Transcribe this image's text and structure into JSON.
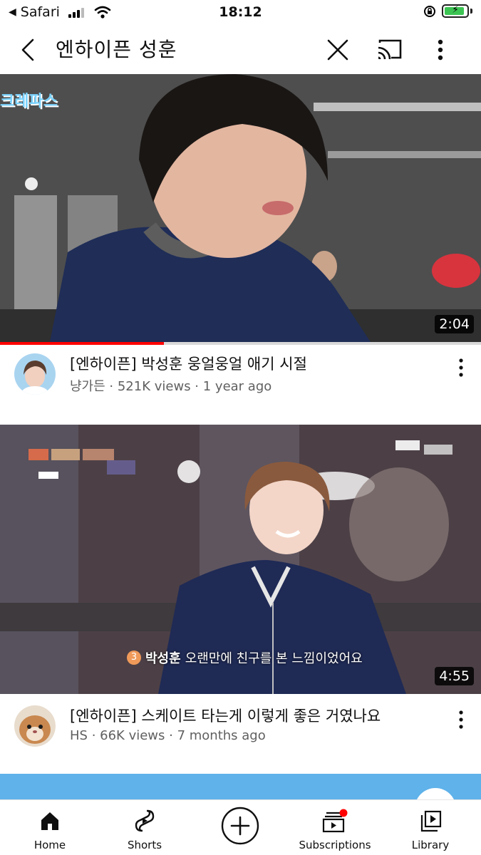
{
  "status_bar": {
    "back_app": "Safari",
    "time": "18:12"
  },
  "search": {
    "query": "엔하이픈 성훈"
  },
  "videos": [
    {
      "title": "[엔하이픈] 박성훈 웅얼웅얼 애기 시절",
      "channel": "냥가든",
      "views": "521K views",
      "age": "1 year ago",
      "duration": "2:04",
      "thumbnail_overlay_text": "크레파스",
      "watch_progress": 0.34
    },
    {
      "title": "[엔하이픈] 스케이트 타는게 이렇게 좋은 거였나요",
      "channel": "HS",
      "views": "66K views",
      "age": "7 months ago",
      "duration": "4:55",
      "subtitle_badge": "3",
      "subtitle_name": "박성훈",
      "subtitle_text": "오랜만에 친구를 본 느낌이었어요"
    }
  ],
  "separator": " · ",
  "bottom_nav": {
    "home": "Home",
    "shorts": "Shorts",
    "subscriptions": "Subscriptions",
    "library": "Library"
  },
  "colors": {
    "accent_red": "#ff0000",
    "text_primary": "#0f0f0f",
    "text_secondary": "#606060",
    "banner_blue": "#5fb2ea",
    "battery_green": "#3cc453"
  }
}
